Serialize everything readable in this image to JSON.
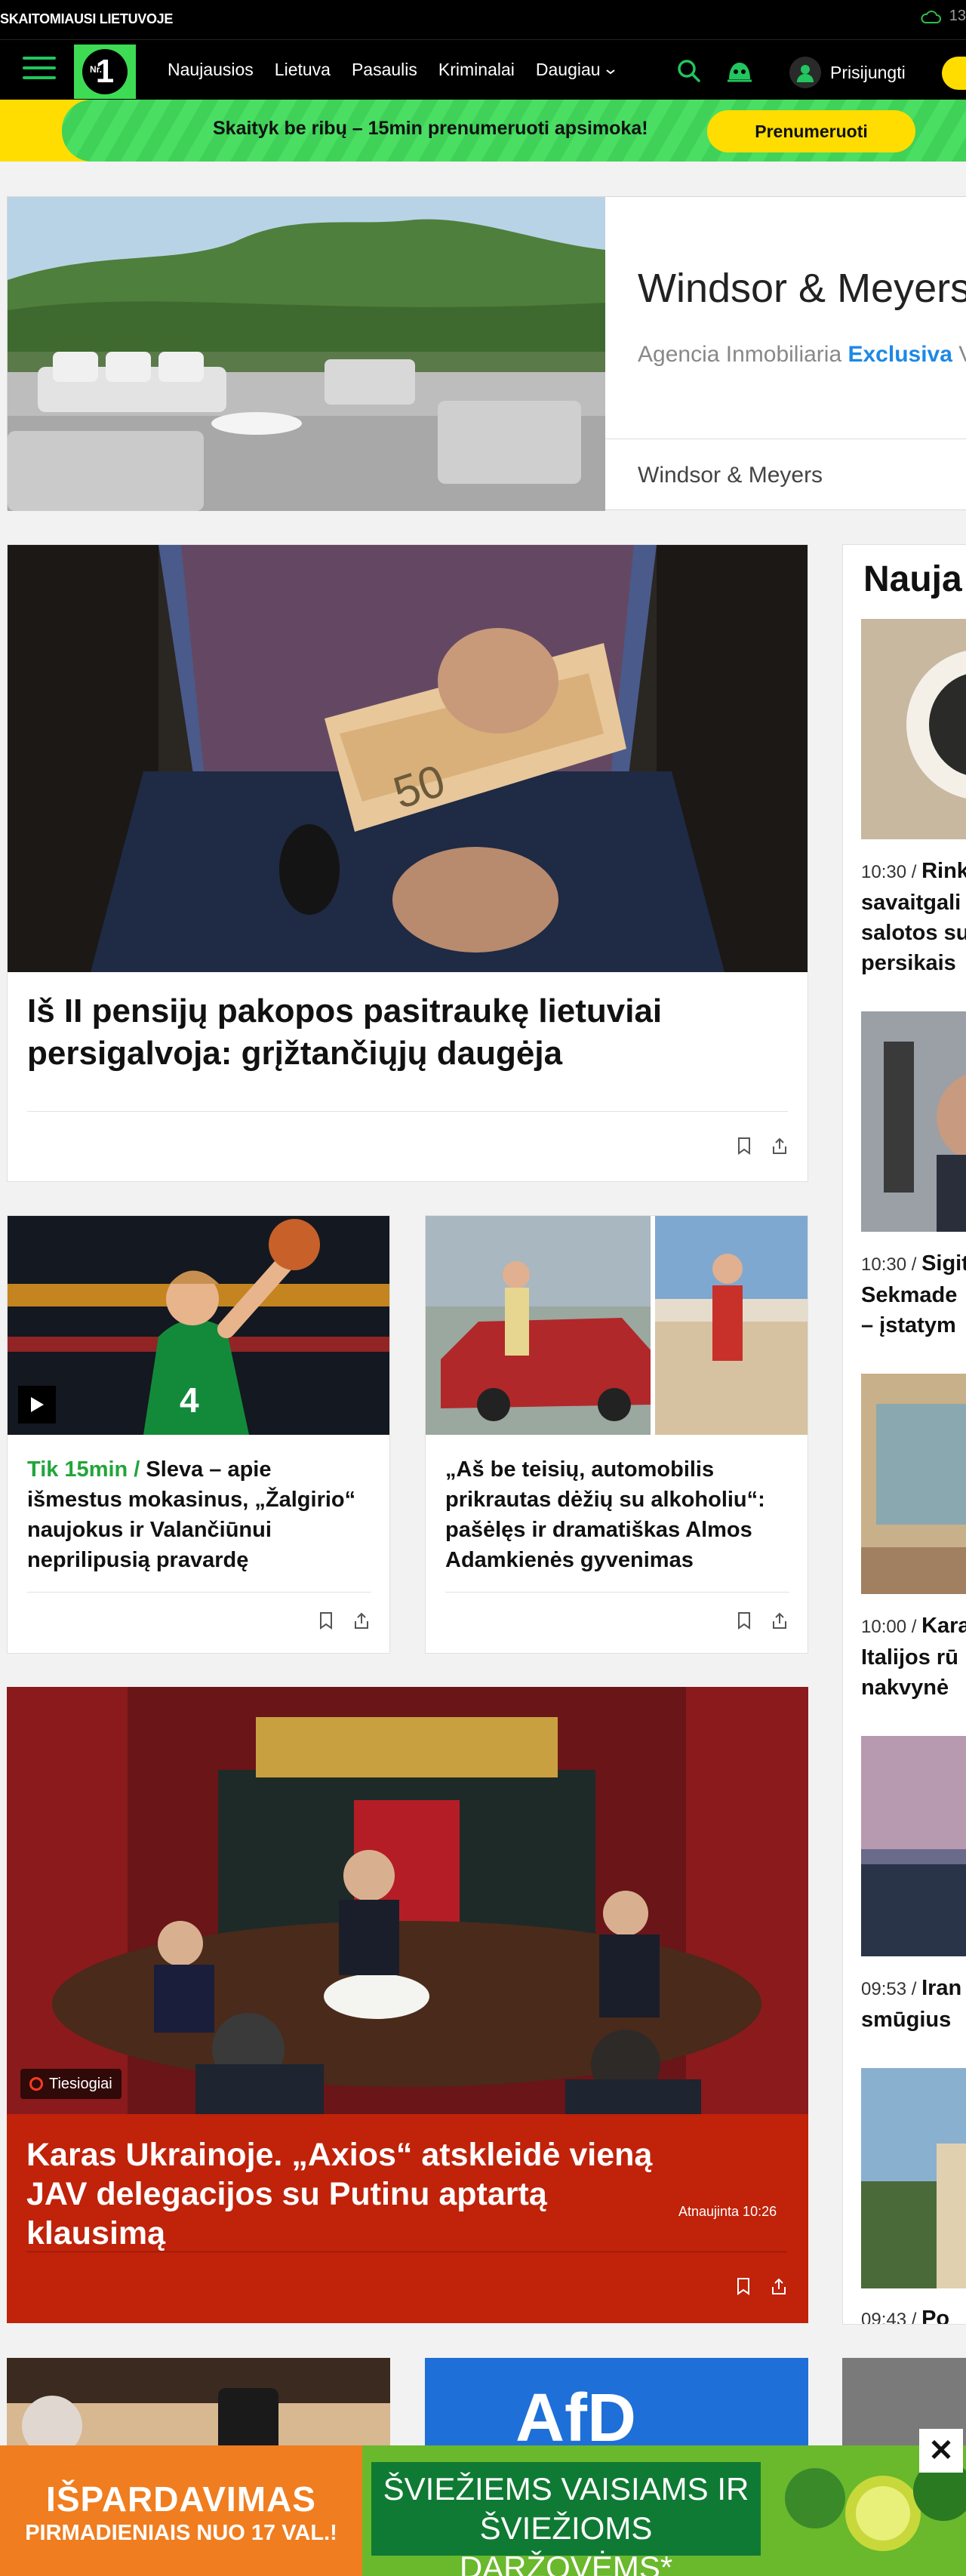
{
  "topbar": {
    "label": "SKAITOMIAUSI LIETUVOJE",
    "temperature": "13"
  },
  "nav": {
    "logo_text": "1",
    "logo_small": "Nr.",
    "links": [
      "Naujausios",
      "Lietuva",
      "Pasaulis",
      "Kriminalai",
      "Daugiau"
    ],
    "login": "Prisijungti"
  },
  "promo": {
    "text": "Skaityk be ribų – 15min prenumeruoti apsimoka!",
    "button": "Prenumeruoti"
  },
  "ad": {
    "title": "Windsor & Meyers",
    "subtitle_plain": "Agencia Inmobiliaria ",
    "subtitle_highlight": "Exclusiva",
    "subtitle_tail": " V",
    "footer": "Windsor & Meyers"
  },
  "hero": {
    "title": "Iš II pensijų pakopos pasitraukę lietuviai persigalvoja: grįžtančiųjų daugėja"
  },
  "card_a": {
    "prefix": "Tik 15min / ",
    "title": "Sleva – apie išmestus mokasinus, „Žalgirio“ naujokus ir Valančiūnui neprilipusią pravardę"
  },
  "card_b": {
    "title": "„Aš be teisių, automobilis prikrautas dėžių su alkoholiu“: pašėlęs ir dramatiškas Almos Adamkienės gyvenimas"
  },
  "red_card": {
    "badge": "Tiesiogiai",
    "title": "Karas Ukrainoje. „Axios“ atskleidė vieną JAV delegacijos su Putinu aptartą klausimą",
    "updated": "Atnaujinta 10:26"
  },
  "sidebar": {
    "heading": "Nauja",
    "items": [
      {
        "time": "10:30 / ",
        "text": "Rink\nsavaitgali\nsalotos su\npersikais"
      },
      {
        "time": "10:30 / ",
        "text": "Sigit\nSekmade\n– įstatym"
      },
      {
        "time": "10:00 / ",
        "text": "Kara\nItalijos rū\nnakvynė"
      },
      {
        "time": "09:53 / ",
        "text": "Iran\nsmūgius"
      },
      {
        "time": "09:43 / ",
        "text": "Po"
      }
    ]
  },
  "bottom_ad": {
    "orange_line1": "IŠPARDAVIMAS",
    "orange_line2": "PIRMADIENIAIS NUO 17 VAL.!",
    "green_line1": "ŠVIEŽIEMS VAISIAMS IR",
    "green_line2": "ŠVIEŽIOMS DARŽOVĖMS*",
    "close": "✕"
  }
}
